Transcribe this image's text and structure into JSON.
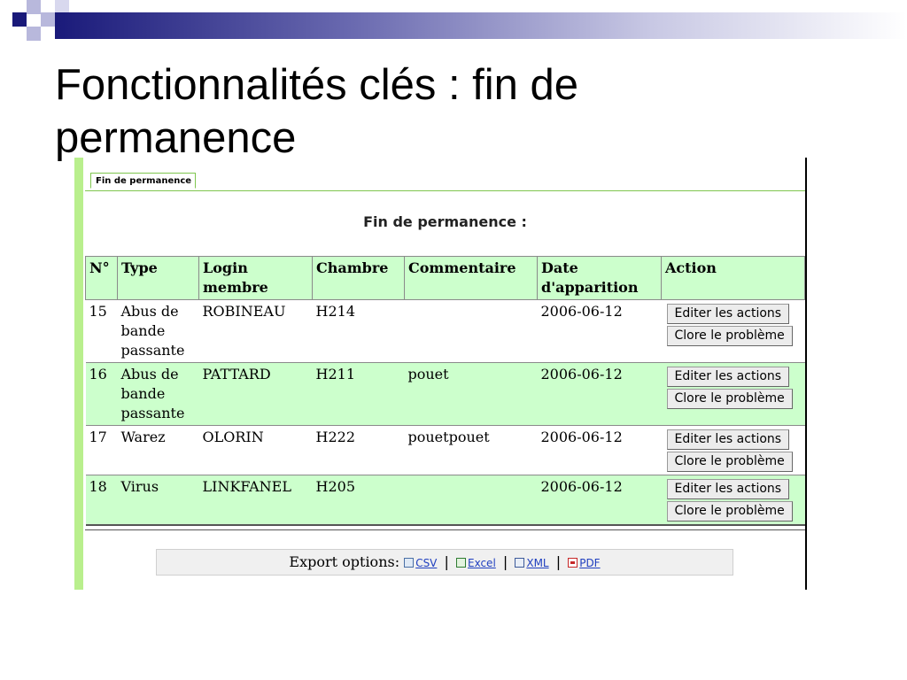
{
  "slide": {
    "title": "Fonctionnalités clés : fin de permanence"
  },
  "tab": {
    "label": "Fin de permanence"
  },
  "heading": "Fin de permanence :",
  "table": {
    "headers": [
      "N°",
      "Type",
      "Login membre",
      "Chambre",
      "Commentaire",
      "Date d'apparition",
      "Action"
    ],
    "rows": [
      {
        "num": "15",
        "type": "Abus de bande passante",
        "login": "ROBINEAU",
        "chambre": "H214",
        "commentaire": "",
        "date": "2006-06-12"
      },
      {
        "num": "16",
        "type": "Abus de bande passante",
        "login": "PATTARD",
        "chambre": "H211",
        "commentaire": "pouet",
        "date": "2006-06-12"
      },
      {
        "num": "17",
        "type": "Warez",
        "login": "OLORIN",
        "chambre": "H222",
        "commentaire": "pouetpouet",
        "date": "2006-06-12"
      },
      {
        "num": "18",
        "type": "Virus",
        "login": "LINKFANEL",
        "chambre": "H205",
        "commentaire": "",
        "date": "2006-06-12"
      }
    ],
    "edit_label": "Editer les actions",
    "close_label": "Clore le problème"
  },
  "export": {
    "label": "Export options:",
    "csv": "CSV",
    "excel": "Excel",
    "xml": "XML",
    "pdf": "PDF"
  },
  "colors": {
    "row_highlight": "#ccffcc",
    "accent_green": "#b9ef8d",
    "title_bar": "#1a1a7a"
  }
}
